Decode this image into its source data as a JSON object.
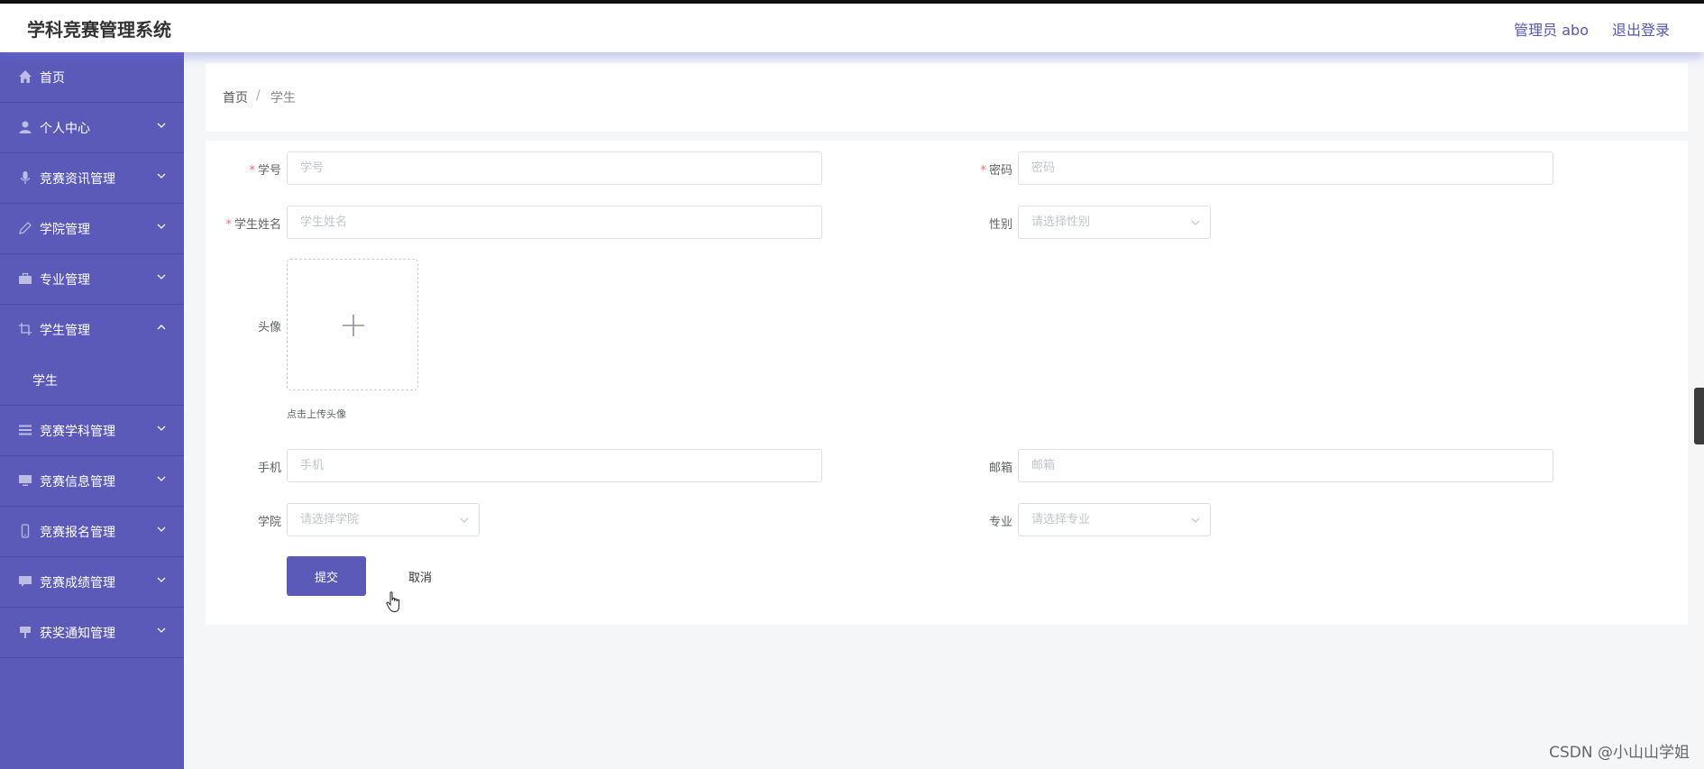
{
  "header": {
    "app_title": "学科竞赛管理系统",
    "admin_label": "管理员 abo",
    "logout_label": "退出登录"
  },
  "sidebar": {
    "items": [
      {
        "label": "首页",
        "icon": "home-icon",
        "arrow": ""
      },
      {
        "label": "个人中心",
        "icon": "user-icon",
        "arrow": "down"
      },
      {
        "label": "竞赛资讯管理",
        "icon": "microphone-icon",
        "arrow": "down"
      },
      {
        "label": "学院管理",
        "icon": "edit-icon",
        "arrow": "down"
      },
      {
        "label": "专业管理",
        "icon": "briefcase-icon",
        "arrow": "down"
      },
      {
        "label": "学生管理",
        "icon": "crop-icon",
        "arrow": "up"
      },
      {
        "label": "竞赛学科管理",
        "icon": "list-icon",
        "arrow": "down"
      },
      {
        "label": "竞赛信息管理",
        "icon": "monitor-icon",
        "arrow": "down"
      },
      {
        "label": "竞赛报名管理",
        "icon": "phone-icon",
        "arrow": "down"
      },
      {
        "label": "竞赛成绩管理",
        "icon": "message-icon",
        "arrow": "down"
      },
      {
        "label": "获奖通知管理",
        "icon": "sign-icon",
        "arrow": "down"
      }
    ],
    "submenu": {
      "label": "学生"
    }
  },
  "breadcrumb": {
    "home": "首页",
    "separator": "/",
    "current": "学生"
  },
  "form": {
    "student_id": {
      "label": "学号",
      "placeholder": "学号",
      "required": true
    },
    "password": {
      "label": "密码",
      "placeholder": "密码",
      "required": true
    },
    "student_name": {
      "label": "学生姓名",
      "placeholder": "学生姓名",
      "required": true
    },
    "gender": {
      "label": "性别",
      "placeholder": "请选择性别"
    },
    "avatar": {
      "label": "头像",
      "hint": "点击上传头像"
    },
    "phone": {
      "label": "手机",
      "placeholder": "手机"
    },
    "email": {
      "label": "邮箱",
      "placeholder": "邮箱"
    },
    "college": {
      "label": "学院",
      "placeholder": "请选择学院"
    },
    "major": {
      "label": "专业",
      "placeholder": "请选择专业"
    },
    "submit_label": "提交",
    "cancel_label": "取消"
  },
  "watermark": "CSDN @小山山学姐",
  "colors": {
    "sidebar_bg": "#5b5ab9",
    "accent": "#5b5ab9",
    "required": "#f56c6c"
  }
}
